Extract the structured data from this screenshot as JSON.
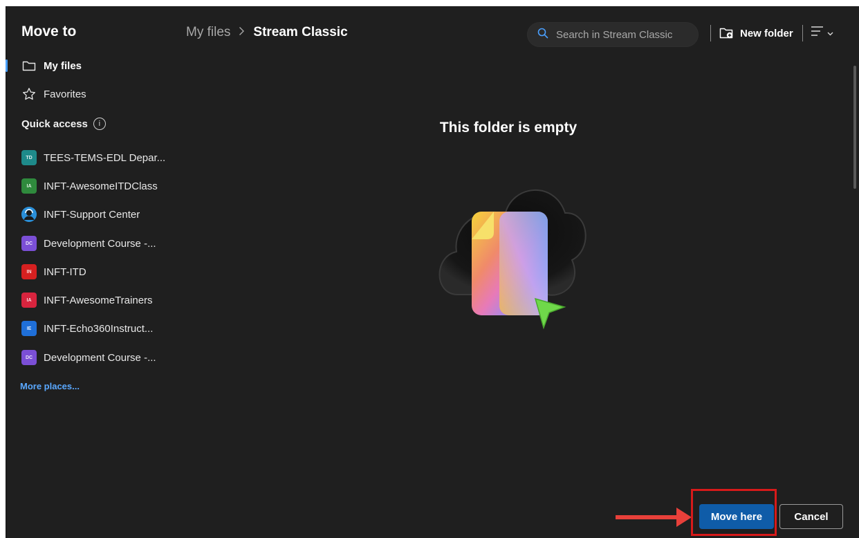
{
  "dialog": {
    "title": "Move to"
  },
  "sidebar": {
    "nav": [
      {
        "label": "My files",
        "icon": "folder-icon",
        "selected": true
      },
      {
        "label": "Favorites",
        "icon": "star-icon",
        "selected": false
      }
    ],
    "quick_access_label": "Quick access",
    "quick_access": [
      {
        "label": "TEES-TEMS-EDL Depar...",
        "badge": "TD",
        "color": "#1e8a8a"
      },
      {
        "label": "INFT-AwesomeITDClass",
        "badge": "IA",
        "color": "#2f8a3d"
      },
      {
        "label": "INFT-Support Center",
        "badge": "",
        "color": "#2a8fd8",
        "avatar": true
      },
      {
        "label": "Development Course -...",
        "badge": "DC",
        "color": "#7b4fd6"
      },
      {
        "label": "INFT-ITD",
        "badge": "IN",
        "color": "#d62020"
      },
      {
        "label": "INFT-AwesomeTrainers",
        "badge": "IA",
        "color": "#d8243e"
      },
      {
        "label": "INFT-Echo360Instruct...",
        "badge": "IE",
        "color": "#1f6fd8"
      },
      {
        "label": "Development Course -...",
        "badge": "DC",
        "color": "#7b4fd6"
      }
    ],
    "more_places": "More places..."
  },
  "header": {
    "breadcrumb_root": "My files",
    "breadcrumb_separator": ">",
    "breadcrumb_current": "Stream Classic",
    "search_placeholder": "Search in Stream Classic",
    "new_folder_label": "New folder"
  },
  "content": {
    "empty_message": "This folder is empty"
  },
  "footer": {
    "move_here_label": "Move here",
    "cancel_label": "Cancel"
  },
  "colors": {
    "background": "#1f1f1f",
    "accent": "#0f5ca8",
    "link": "#5aa8ff",
    "highlight": "#d71a1a"
  }
}
